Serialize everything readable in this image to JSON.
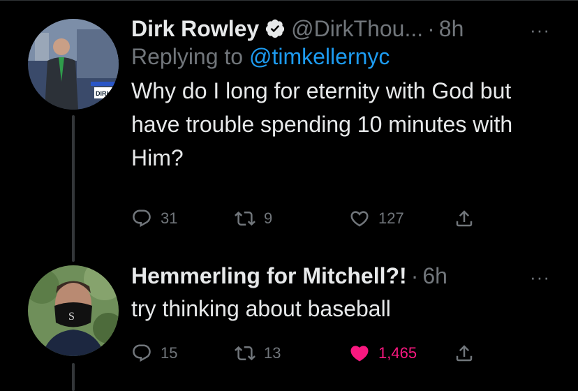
{
  "tweets": [
    {
      "display_name": "Dirk Rowley",
      "handle": "@DirkThou...",
      "separator": "·",
      "time": "8h",
      "more_label": "···",
      "replying_to_label": "Replying to",
      "replying_to_handle": "@timkellernyc",
      "text": "Why do I long for eternity with God but have trouble spending 10 minutes with Him?",
      "replies": "31",
      "retweets": "9",
      "likes": "127",
      "verified": true,
      "avatar_text": "DIRK",
      "liked": false
    },
    {
      "display_name": "Hemmerling for Mitchell?!",
      "separator": "·",
      "time": "6h",
      "more_label": "···",
      "text": "try thinking about baseball",
      "replies": "15",
      "retweets": "13",
      "likes": "1,465",
      "liked": true
    }
  ],
  "colors": {
    "background": "#000000",
    "text": "#e7e9ea",
    "muted": "#71767b",
    "link": "#1d9bf0",
    "like": "#f91880",
    "verified": "#e7e9ea"
  }
}
